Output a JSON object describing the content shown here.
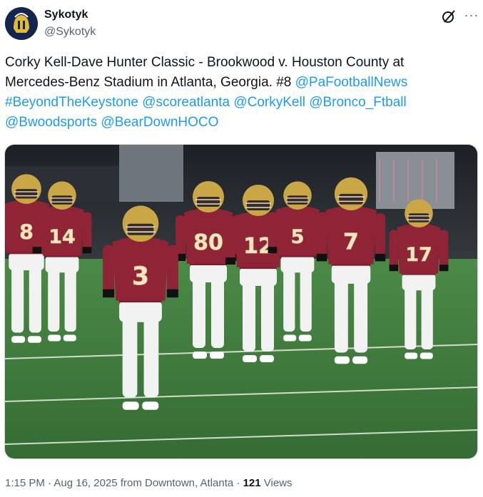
{
  "author": {
    "name": "Sykotyk",
    "handle": "@Sykotyk",
    "avatar_icon": "spartan-helmet-avatar"
  },
  "actions": {
    "grok_icon": "grok-icon",
    "more_icon": "more-options-icon",
    "more_glyph": "···"
  },
  "tweet": {
    "text": "Corky Kell-Dave Hunter Classic - Brookwood v. Houston County at Mercedes-Benz Stadium in Atlanta, Georgia. #8 ",
    "mentions": [
      "@PaFootballNews",
      "#BeyondTheKeystone",
      "@scoreatlanta",
      "@CorkyKell",
      "@Bronco_Ftball",
      "@Bwoodsports",
      "@BearDownHOCO"
    ]
  },
  "media": {
    "type": "photo",
    "jerseys": [
      "8",
      "14",
      "3",
      "80",
      "12",
      "5",
      "7",
      "17"
    ]
  },
  "meta": {
    "time": "1:15 PM",
    "date": "Aug 16, 2025",
    "location": "from Downtown, Atlanta",
    "views_count": "121",
    "views_label": "Views",
    "separator": "·"
  },
  "colors": {
    "link": "#1d9bf0",
    "secondary_text": "#536471",
    "jersey_maroon": "#8e2436",
    "helmet_gold": "#c9a646",
    "field_green": "#3f7a3e"
  }
}
